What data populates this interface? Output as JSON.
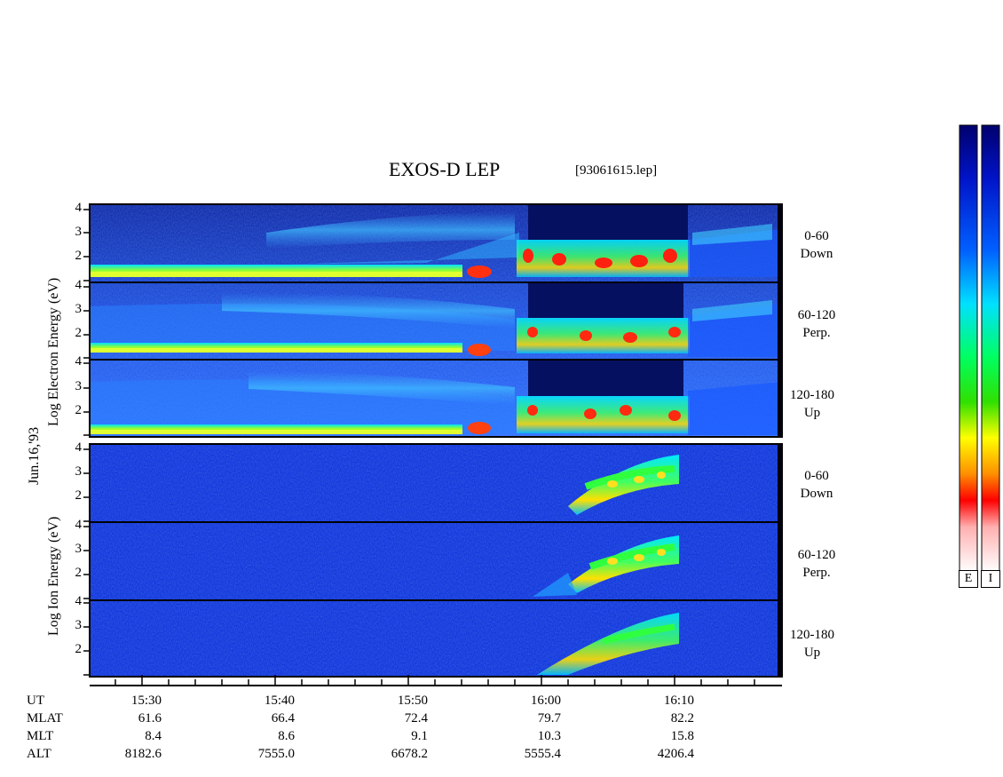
{
  "header": {
    "title": "EXOS-D LEP",
    "file_name": "[93061615.lep]"
  },
  "date_label": "Jun.16,'93",
  "electron_axis_label": "Log Electron Energy (eV)",
  "ion_axis_label": "Log Ion Energy (eV)",
  "panel_labels": [
    {
      "range": "0-60",
      "dir": "Down"
    },
    {
      "range": "60-120",
      "dir": "Perp."
    },
    {
      "range": "120-180",
      "dir": "Up"
    },
    {
      "range": "0-60",
      "dir": "Down"
    },
    {
      "range": "60-120",
      "dir": "Perp."
    },
    {
      "range": "120-180",
      "dir": "Up"
    }
  ],
  "y_ticks": [
    "4",
    "3",
    "2"
  ],
  "time_axis": {
    "row_names": [
      "UT",
      "MLAT",
      "MLT",
      "ALT"
    ],
    "columns": [
      {
        "ut": "15:30",
        "mlat": "61.6",
        "mlt": "8.4",
        "alt": "8182.6"
      },
      {
        "ut": "15:40",
        "mlat": "66.4",
        "mlt": "8.6",
        "alt": "7555.0"
      },
      {
        "ut": "15:50",
        "mlat": "72.4",
        "mlt": "9.1",
        "alt": "6678.2"
      },
      {
        "ut": "16:00",
        "mlat": "79.7",
        "mlt": "10.3",
        "alt": "5555.4"
      },
      {
        "ut": "16:10",
        "mlat": "82.2",
        "mlt": "15.8",
        "alt": "4206.4"
      }
    ]
  },
  "colorbar": {
    "labels": [
      "E",
      "I"
    ]
  },
  "colors": {
    "background_low": "#0a28c8",
    "high": "#ff1a1a",
    "mid": "#2ee84a",
    "frame": "#000000"
  },
  "chart_data": {
    "type": "heatmap",
    "title": "EXOS-D LEP",
    "xlabel": "UT",
    "ylabel": "Log Energy (eV)",
    "xlim": [
      "15:25",
      "16:18"
    ],
    "ylim": [
      1,
      4.2
    ],
    "panels": [
      {
        "species": "Electron",
        "pitch": "0-60",
        "dir": "Down"
      },
      {
        "species": "Electron",
        "pitch": "60-120",
        "dir": "Perp."
      },
      {
        "species": "Electron",
        "pitch": "120-180",
        "dir": "Up"
      },
      {
        "species": "Ion",
        "pitch": "0-60",
        "dir": "Down"
      },
      {
        "species": "Ion",
        "pitch": "60-120",
        "dir": "Perp."
      },
      {
        "species": "Ion",
        "pitch": "120-180",
        "dir": "Up"
      }
    ]
  }
}
